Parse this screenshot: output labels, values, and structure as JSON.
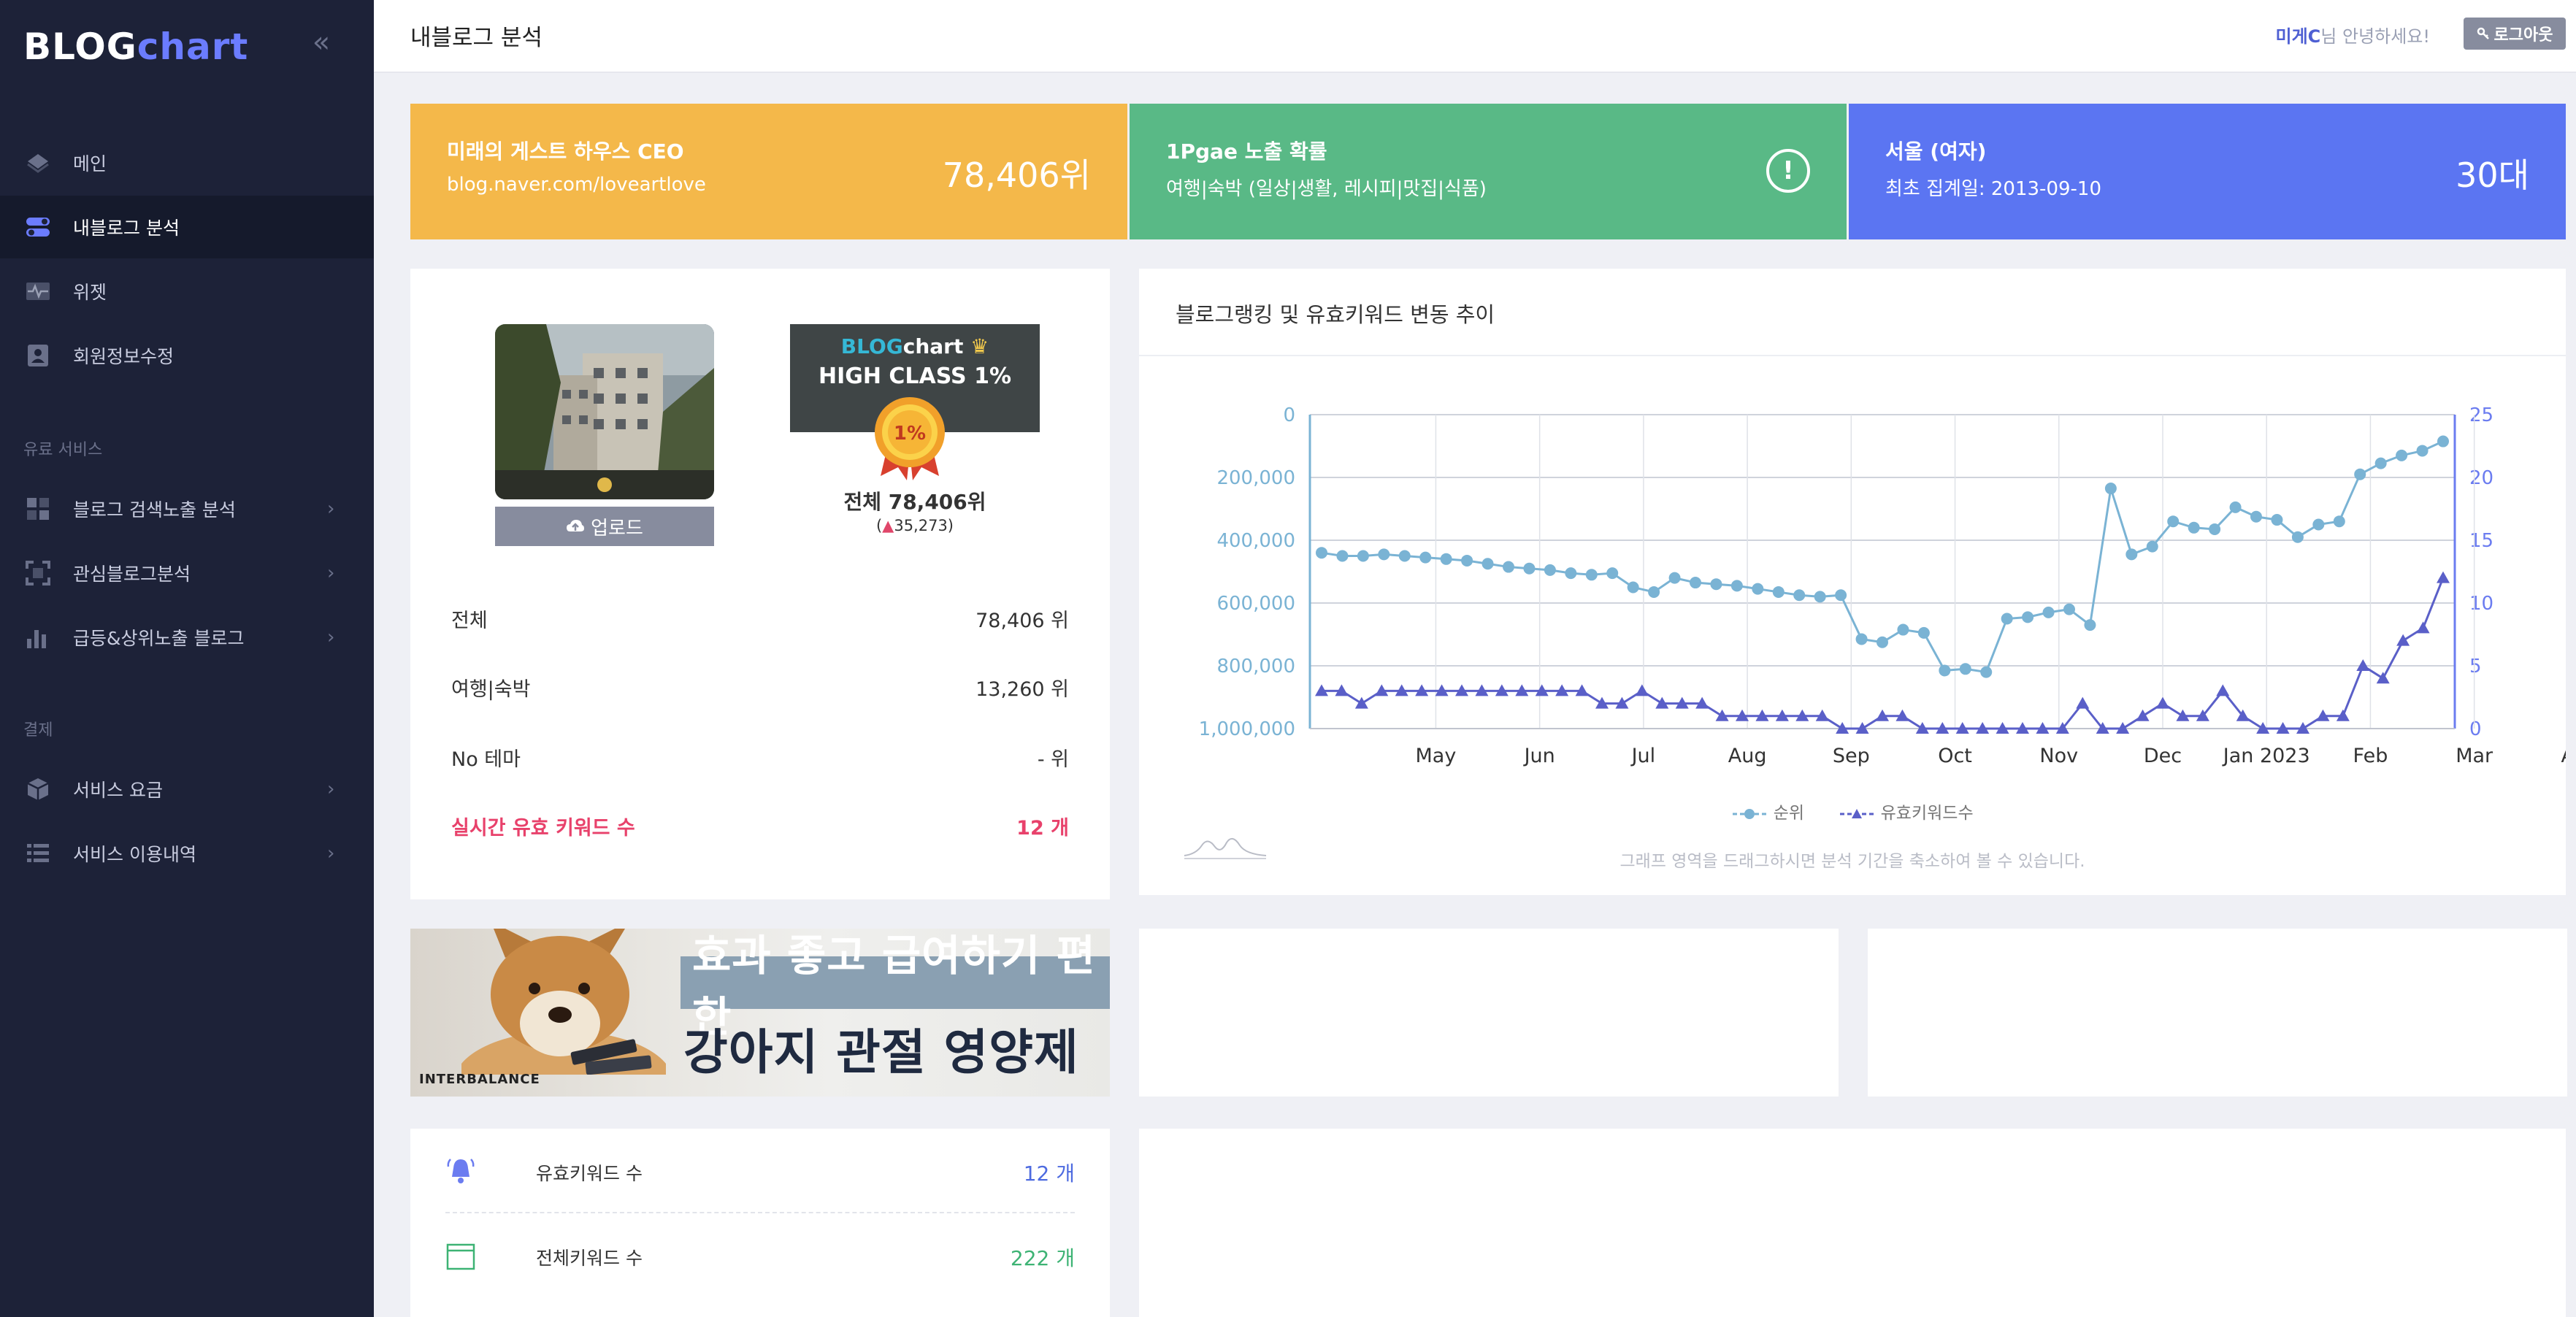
{
  "sidebar": {
    "logo_blog": "BLOG",
    "logo_chart": "chart",
    "collapse_glyph": "«",
    "items": [
      {
        "label": "메인",
        "icon": "diamond-icon"
      },
      {
        "label": "내블로그 분석",
        "icon": "toggle-icon",
        "active": true
      },
      {
        "label": "위젯",
        "icon": "pulse-icon"
      },
      {
        "label": "회원정보수정",
        "icon": "user-card-icon"
      }
    ],
    "section_paid": "유료 서비스",
    "paid_items": [
      {
        "label": "블로그 검색노출 분석",
        "icon": "grid-icon"
      },
      {
        "label": "관심블로그분석",
        "icon": "frame-icon"
      },
      {
        "label": "급등&상위노출 블로그",
        "icon": "bar-chart-icon"
      }
    ],
    "section_payment": "결제",
    "payment_items": [
      {
        "label": "서비스 요금",
        "icon": "box-icon"
      },
      {
        "label": "서비스 이용내역",
        "icon": "list-icon"
      }
    ],
    "chevron": "›"
  },
  "topbar": {
    "title": "내블로그 분석",
    "user_name": "미게C",
    "greeting_suffix": "님 안녕하세요!",
    "logout_label": "로그아웃"
  },
  "stats": {
    "blog": {
      "title": "미래의 게스트 하우스 CEO",
      "url": "blog.naver.com/loveartlove",
      "rank": "78,406위"
    },
    "exposure": {
      "title": "1Pgae 노출 확률",
      "categories": "여행|숙박 (일상|생활, 레시피|맛집|식품)",
      "icon_glyph": "!"
    },
    "user": {
      "title": "서울 (여자)",
      "first_date": "최초 집계일: 2013-09-10",
      "age": "30대"
    }
  },
  "profile": {
    "upload_label": "업로드",
    "badge_blog": "BLOG",
    "badge_chart": "chart",
    "badge_class": "HIGH CLASS 1%",
    "medal_text": "1%",
    "rank_total": "전체 78,406위",
    "rank_change_open": "(",
    "rank_change_arrow": "▲",
    "rank_change_value": "35,273)",
    "rows": [
      {
        "label": "전체",
        "value": "78,406 위"
      },
      {
        "label": "여행|숙박",
        "value": "13,260 위"
      },
      {
        "label": "No 테마",
        "value": "- 위"
      },
      {
        "label": "실시간 유효 키워드 수",
        "value": "12 개",
        "highlight": true
      }
    ]
  },
  "chart_card": {
    "title": "블로그랭킹 및 유효키워드 변동 추이",
    "hint": "그래프 영역을 드래그하시면 분석 기간을 축소하여 볼 수 있습니다.",
    "legend_rank": "순위",
    "legend_kw": "유효키워드수"
  },
  "chart_data": {
    "type": "line",
    "title": "블로그랭킹 및 유효키워드 변동 추이",
    "x_tick_labels": [
      "May",
      "Jun",
      "Jul",
      "Aug",
      "Sep",
      "Oct",
      "Nov",
      "Dec",
      "Jan 2023",
      "Feb",
      "Mar",
      "Apr"
    ],
    "x_label_index": [
      5.5,
      10.5,
      15.5,
      20.5,
      25.5,
      30.5,
      35.5,
      40.5,
      45.5,
      50.5,
      55.5,
      60.5
    ],
    "y_left": {
      "ticks": [
        "0",
        "200,000",
        "400,000",
        "600,000",
        "800,000",
        "1,000,000"
      ],
      "range": [
        0,
        1000000
      ],
      "reversed": true
    },
    "y_right": {
      "ticks": [
        "25",
        "20",
        "15",
        "10",
        "5",
        "0"
      ],
      "range": [
        0,
        25
      ]
    },
    "grid": true,
    "legend_position": "bottom-center",
    "colors": {
      "rank": "#7ab3d4",
      "keywords": "#5a5fc8"
    },
    "series": [
      {
        "name": "순위",
        "axis": "left",
        "values": [
          440000,
          450000,
          450000,
          445000,
          450000,
          455000,
          460000,
          465000,
          475000,
          485000,
          490000,
          495000,
          505000,
          510000,
          505000,
          550000,
          565000,
          520000,
          535000,
          540000,
          545000,
          555000,
          565000,
          575000,
          580000,
          575000,
          715000,
          725000,
          685000,
          695000,
          815000,
          810000,
          820000,
          650000,
          645000,
          630000,
          620000,
          670000,
          235000,
          445000,
          420000,
          340000,
          360000,
          365000,
          295000,
          325000,
          335000,
          390000,
          350000,
          340000,
          190000,
          155000,
          130000,
          115000,
          85000
        ]
      },
      {
        "name": "유효키워드수",
        "axis": "right",
        "values": [
          3,
          3,
          2,
          3,
          3,
          3,
          3,
          3,
          3,
          3,
          3,
          3,
          3,
          3,
          2,
          2,
          3,
          2,
          2,
          2,
          1,
          1,
          1,
          1,
          1,
          1,
          0,
          0,
          1,
          1,
          0,
          0,
          0,
          0,
          0,
          0,
          0,
          0,
          2,
          0,
          0,
          1,
          2,
          1,
          1,
          3,
          1,
          0,
          0,
          0,
          1,
          1,
          5,
          4,
          7,
          8,
          12
        ]
      }
    ]
  },
  "banner": {
    "line1": "효과 좋고 급여하기 편한",
    "line2": "강아지 관절 영양제",
    "brand": "INTERBALANCE"
  },
  "keywords": {
    "rows": [
      {
        "label": "유효키워드 수",
        "value": "12 개",
        "color": "#4e6be0",
        "icon": "bell-icon"
      },
      {
        "label": "전체키워드 수",
        "value": "222 개",
        "color": "#3db374",
        "icon": "calendar-icon"
      }
    ]
  }
}
